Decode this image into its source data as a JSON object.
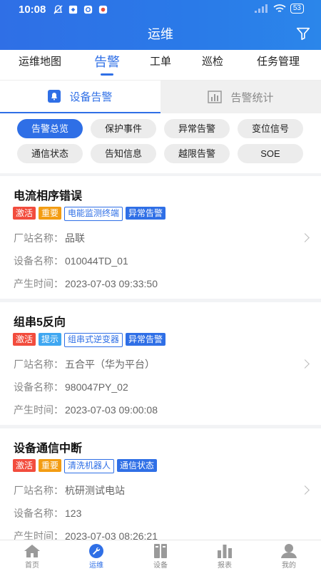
{
  "status_bar": {
    "time": "10:08",
    "battery": "53"
  },
  "header": {
    "title": "运维"
  },
  "tabs": [
    {
      "label": "运维地图"
    },
    {
      "label": "告警"
    },
    {
      "label": "工单"
    },
    {
      "label": "巡检"
    },
    {
      "label": "任务管理"
    }
  ],
  "active_tab": "告警",
  "subtabs": {
    "left": "设备告警",
    "right": "告警统计"
  },
  "chips": [
    {
      "label": "告警总览"
    },
    {
      "label": "保护事件"
    },
    {
      "label": "异常告警"
    },
    {
      "label": "变位信号"
    },
    {
      "label": "通信状态"
    },
    {
      "label": "告知信息"
    },
    {
      "label": "越限告警"
    },
    {
      "label": "SOE"
    }
  ],
  "active_chip": "告警总览",
  "alarms": [
    {
      "title": "电流相序错误",
      "tags": [
        "激活",
        "重要",
        "电能监测终端",
        "异常告警"
      ],
      "station_label": "厂站名称：",
      "station": "品联",
      "device_label": "设备名称：",
      "device": "010044TD_01",
      "time_label": "产生时间：",
      "time": "2023-07-03 09:33:50"
    },
    {
      "title": "组串5反向",
      "tags": [
        "激活",
        "提示",
        "组串式逆变器",
        "异常告警"
      ],
      "station_label": "厂站名称：",
      "station": "五合平（华为平台）",
      "device_label": "设备名称：",
      "device": "980047PY_02",
      "time_label": "产生时间：",
      "time": "2023-07-03 09:00:08"
    },
    {
      "title": "设备通信中断",
      "tags": [
        "激活",
        "重要",
        "清洗机器人",
        "通信状态"
      ],
      "station_label": "厂站名称：",
      "station": "杭研测试电站",
      "device_label": "设备名称：",
      "device": "123",
      "time_label": "产生时间：",
      "time": "2023-07-03 08:26:21"
    }
  ],
  "bottom_nav": [
    {
      "label": "首页",
      "icon": "home-icon"
    },
    {
      "label": "运维",
      "icon": "wrench-icon"
    },
    {
      "label": "设备",
      "icon": "device-icon"
    },
    {
      "label": "报表",
      "icon": "report-icon"
    },
    {
      "label": "我的",
      "icon": "user-icon"
    }
  ],
  "colors": {
    "primary": "#2f6fe6",
    "danger": "#f24c3d",
    "warning": "#f39c12",
    "info": "#3fa7f1"
  }
}
